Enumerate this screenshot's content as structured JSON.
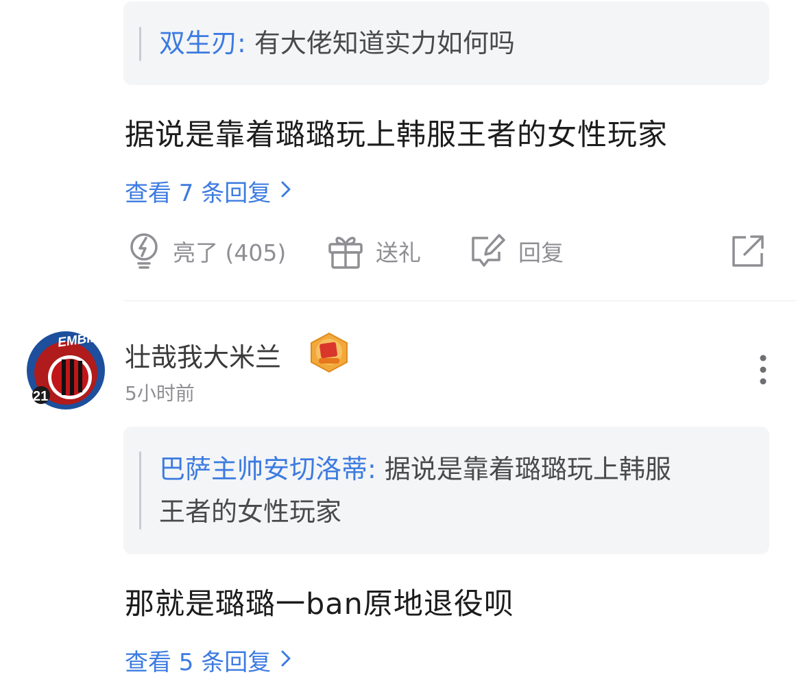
{
  "comment1": {
    "quote": {
      "user": "双生刃",
      "separator": ": ",
      "text": "有大佬知道实力如何吗"
    },
    "body": "据说是靠着璐璐玩上韩服王者的女性玩家",
    "view_replies": "查看 7 条回复",
    "actions": {
      "like_label": "亮了 (405)",
      "gift_label": "送礼",
      "reply_label": "回复"
    }
  },
  "comment2": {
    "avatar": {
      "badge_text": "EMBIID",
      "number": "21"
    },
    "username": "壮哉我大米兰",
    "timestamp": "5小时前",
    "quote": {
      "user": "巴萨主帅安切洛蒂",
      "separator": ": ",
      "text_line1": "据说是靠着璐璐玩上韩服",
      "text_line2": "王者的女性玩家"
    },
    "body": "那就是璐璐一ban原地退役呗",
    "view_replies": "查看 5 条回复"
  },
  "icons": {
    "like": "lightbulb-icon",
    "gift": "gift-icon",
    "reply": "edit-reply-icon",
    "share": "share-external-icon",
    "more": "more-vertical-icon",
    "chevron": "chevron-right-icon",
    "level_badge": "level-badge-icon"
  },
  "colors": {
    "link": "#3c7be0",
    "muted": "#8e8e93",
    "quote_bg": "#f4f5f7"
  }
}
